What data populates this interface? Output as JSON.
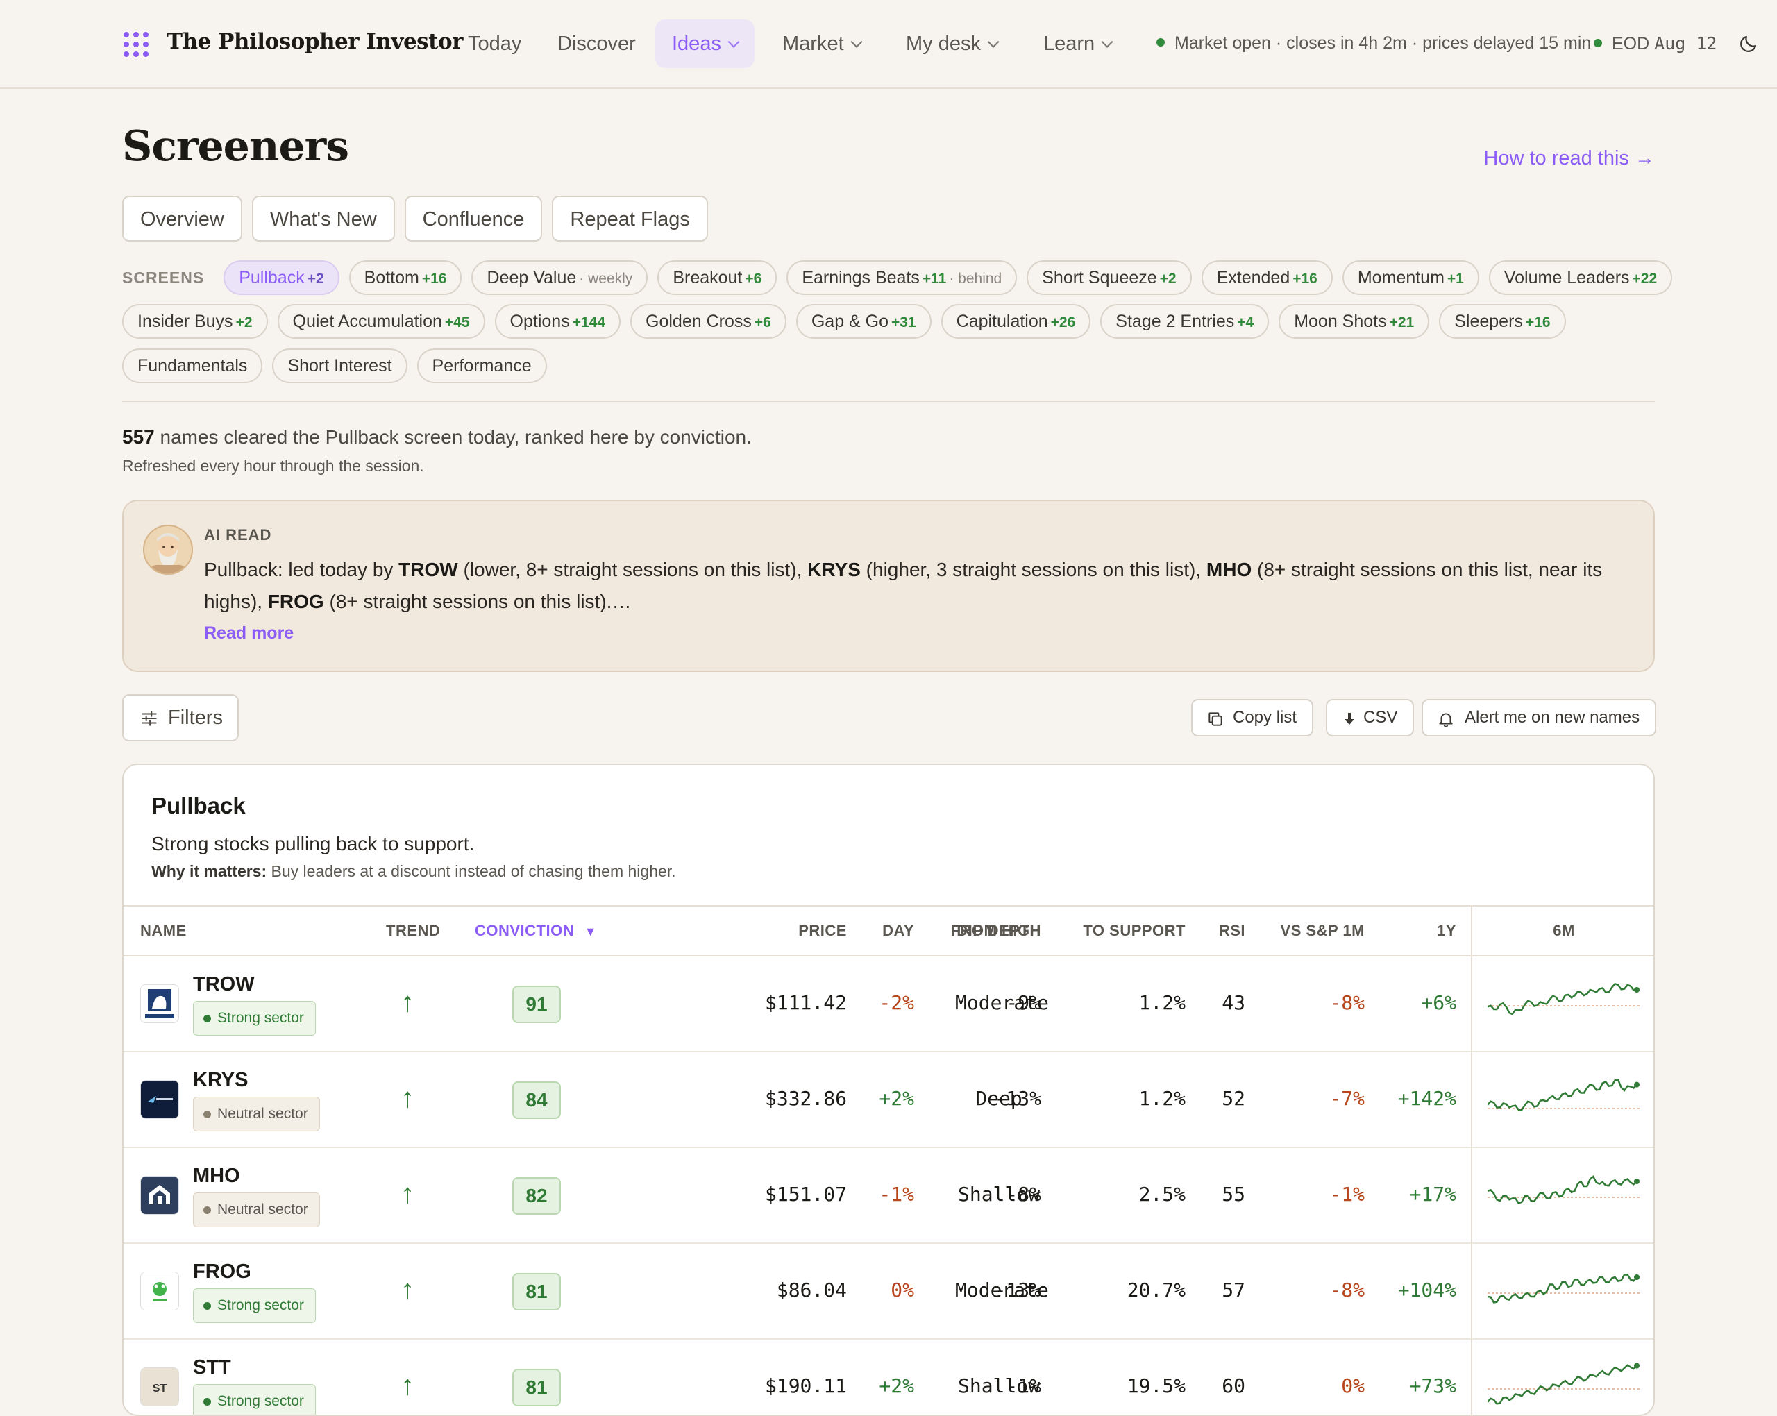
{
  "brand": "The Philosopher Investor",
  "nav": {
    "items": [
      {
        "label": "Today"
      },
      {
        "label": "Discover"
      },
      {
        "label": "Ideas"
      },
      {
        "label": "Market"
      },
      {
        "label": "My desk"
      },
      {
        "label": "Learn"
      }
    ],
    "status": "Market open · closes in 4h 2m · prices delayed 15 min",
    "eod_label": "EOD",
    "eod_date": "Aug 12",
    "status_color": "#2f8a3a"
  },
  "page": {
    "title": "Screeners",
    "how_to_read": "How to read this →",
    "tabs": [
      "Overview",
      "What's New",
      "Confluence",
      "Repeat Flags"
    ],
    "screens_label": "SCREENS"
  },
  "screens": [
    {
      "name": "Pullback",
      "count": "+2",
      "active": true
    },
    {
      "name": "Bottom",
      "count": "+16"
    },
    {
      "name": "Deep Value",
      "note": "· weekly"
    },
    {
      "name": "Breakout",
      "count": "+6"
    },
    {
      "name": "Earnings Beats",
      "count": "+11",
      "note": "· behind"
    },
    {
      "name": "Short Squeeze",
      "count": "+2"
    },
    {
      "name": "Extended",
      "count": "+16"
    },
    {
      "name": "Momentum",
      "count": "+1"
    },
    {
      "name": "Volume Leaders",
      "count": "+22"
    },
    {
      "name": "Insider Buys",
      "count": "+2"
    },
    {
      "name": "Quiet Accumulation",
      "count": "+45"
    },
    {
      "name": "Options",
      "count": "+144"
    },
    {
      "name": "Golden Cross",
      "count": "+6"
    },
    {
      "name": "Gap & Go",
      "count": "+31"
    },
    {
      "name": "Capitulation",
      "count": "+26"
    },
    {
      "name": "Stage 2 Entries",
      "count": "+4"
    },
    {
      "name": "Moon Shots",
      "count": "+21"
    },
    {
      "name": "Sleepers",
      "count": "+16"
    },
    {
      "name": "Fundamentals"
    },
    {
      "name": "Short Interest"
    },
    {
      "name": "Performance"
    }
  ],
  "summary": {
    "count": "557",
    "text": " names cleared the Pullback screen today, ranked here by conviction.",
    "refresh": "Refreshed every hour through the session."
  },
  "ai_read": {
    "label": "AI READ",
    "p1": "Pullback: led today by ",
    "t1": "TROW",
    "p2": " (lower, 8+ straight sessions on this list), ",
    "t2": "KRYS",
    "p3": " (higher, 3 straight sessions on this list), ",
    "t3": "MHO",
    "p4": " (8+ straight sessions on this list, near its highs), ",
    "t4": "FROG",
    "p5": " (8+ straight sessions on this list).…",
    "read_more": "Read more"
  },
  "toolbar": {
    "filters": "Filters",
    "copy": "Copy list",
    "csv": "CSV",
    "alert": "Alert me on new names"
  },
  "card": {
    "title": "Pullback",
    "desc": "Strong stocks pulling back to support.",
    "why_label": "Why it matters:",
    "why_text": " Buy leaders at a discount instead of chasing them higher."
  },
  "columns": {
    "name": "NAME",
    "trend": "TREND",
    "conviction": "CONVICTION",
    "sort_arrow": "▼",
    "price": "PRICE",
    "day": "DAY",
    "from_high": "FROM HIGH",
    "dip_depth": "DIP DEPTH",
    "to_support": "TO SUPPORT",
    "rsi": "RSI",
    "vs_sp": "VS S&P 1M",
    "y1": "1Y",
    "m6": "6M"
  },
  "rows": [
    {
      "ticker": "TROW",
      "sector": "Strong sector",
      "trend": "↑",
      "conviction": "91",
      "price": "$111.42",
      "day": "-2%",
      "from_high": "-9%",
      "dip": "Moderate",
      "to_support": "1.2%",
      "rsi": "43",
      "vs_sp": "-8%",
      "y1": "+6%",
      "logo_text": "T.RowePrice"
    },
    {
      "ticker": "KRYS",
      "sector": "Neutral sector",
      "trend": "↑",
      "conviction": "84",
      "price": "$332.86",
      "day": "+2%",
      "from_high": "-13%",
      "dip": "Deep",
      "to_support": "1.2%",
      "rsi": "52",
      "vs_sp": "-7%",
      "y1": "+142%",
      "logo_text": "Krystal"
    },
    {
      "ticker": "MHO",
      "sector": "Neutral sector",
      "trend": "↑",
      "conviction": "82",
      "price": "$151.07",
      "day": "-1%",
      "from_high": "-8%",
      "dip": "Shallow",
      "to_support": "2.5%",
      "rsi": "55",
      "vs_sp": "-1%",
      "y1": "+17%",
      "logo_text": ""
    },
    {
      "ticker": "FROG",
      "sector": "Strong sector",
      "trend": "↑",
      "conviction": "81",
      "price": "$86.04",
      "day": "0%",
      "from_high": "-13%",
      "dip": "Moderate",
      "to_support": "20.7%",
      "rsi": "57",
      "vs_sp": "-8%",
      "y1": "+104%",
      "logo_text": "JFrog"
    },
    {
      "ticker": "STT",
      "sector": "Strong sector",
      "trend": "↑",
      "conviction": "81",
      "price": "$190.11",
      "day": "+2%",
      "from_high": "-1%",
      "dip": "Shallow",
      "to_support": "19.5%",
      "rsi": "60",
      "vs_sp": "0%",
      "y1": "+73%",
      "logo_text": "ST"
    }
  ],
  "colors": {
    "accent": "#8b5cf6",
    "positive": "#2f7a34",
    "negative": "#b8461c",
    "background": "#f7f4ef"
  }
}
